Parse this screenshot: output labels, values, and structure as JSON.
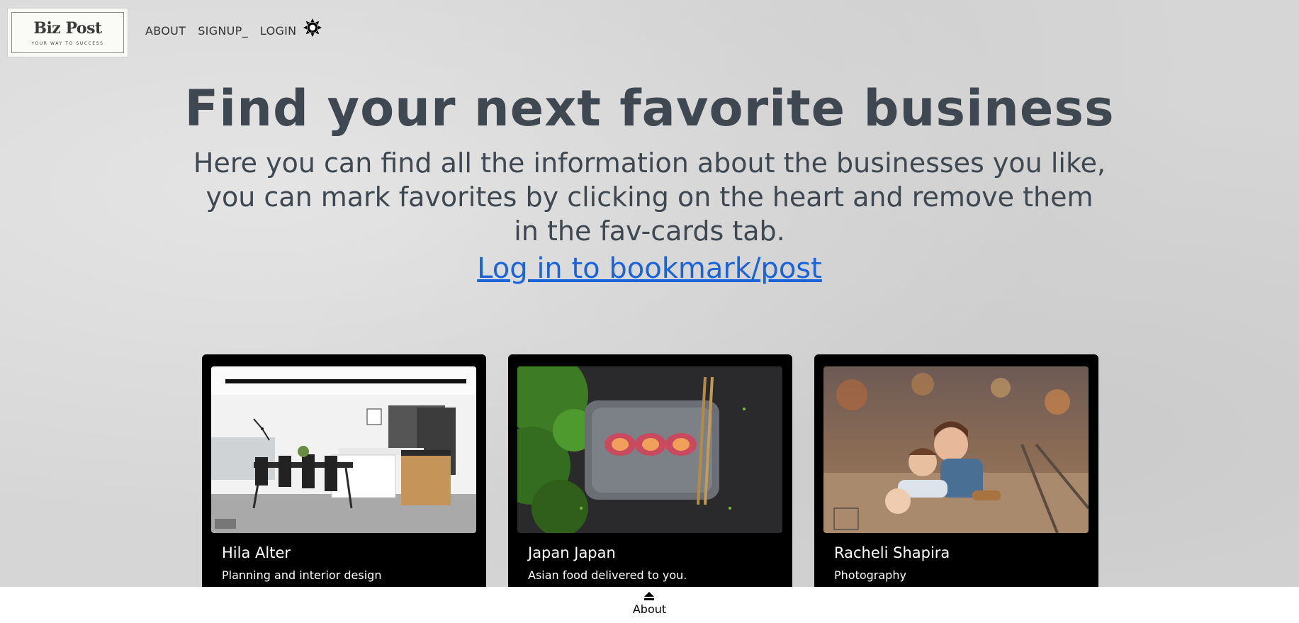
{
  "nav": {
    "logo": {
      "title": "Biz Post",
      "tagline": "YOUR WAY TO SUCCESS"
    },
    "links": [
      {
        "label": "ABOUT"
      },
      {
        "label": "SIGNUP_"
      },
      {
        "label": "LOGIN"
      }
    ],
    "theme_toggle_icon": "sun-icon"
  },
  "hero": {
    "title": "Find your next favorite business",
    "description": "Here you can find all the information about the businesses you like, you can mark favorites by clicking on the heart and remove them in the fav-cards tab.",
    "link_label": "Log in to bookmark/post",
    "link_color": "#1a63d8"
  },
  "cards": [
    {
      "title": "Hila Alter",
      "subtitle": "Planning and interior design",
      "image": "kitchen-dining-photo"
    },
    {
      "title": "Japan Japan",
      "subtitle": "Asian food delivered to you.",
      "image": "sushi-plate-photo"
    },
    {
      "title": "Racheli Shapira",
      "subtitle": "Photography",
      "image": "children-railway-photo"
    }
  ],
  "footer": {
    "label": "About",
    "icon": "eject-icon"
  }
}
